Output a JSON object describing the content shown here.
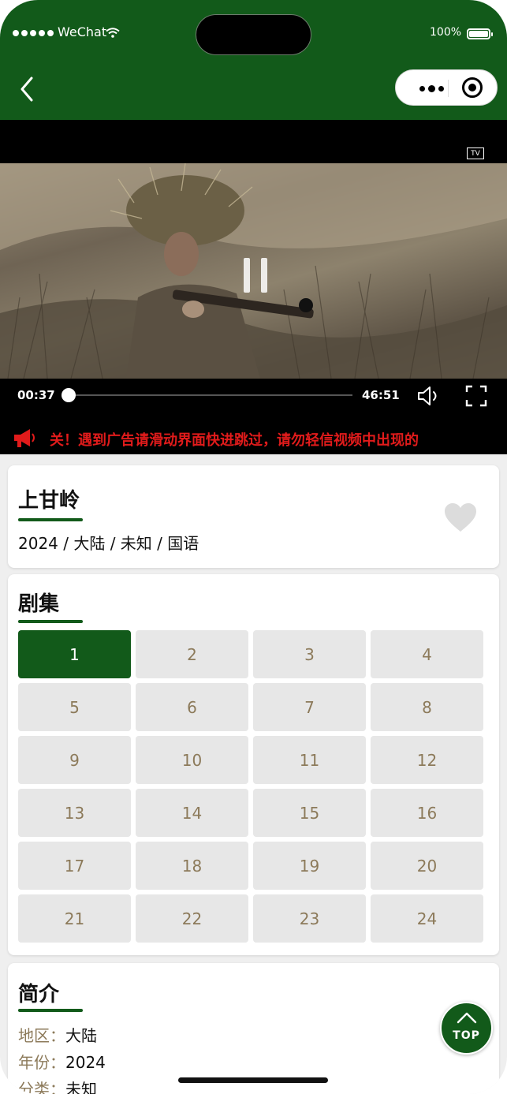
{
  "status_bar": {
    "carrier": "WeChat",
    "battery": "100%"
  },
  "video": {
    "badge": "TV",
    "current_time": "00:37",
    "total_time": "46:51",
    "progress": 0.013
  },
  "notice": {
    "text": "关！遇到广告请滑动界面快进跳过，请勿轻信视频中出现的"
  },
  "show": {
    "title": "上甘岭",
    "meta": "2024 / 大陆 / 未知 / 国语"
  },
  "episodes": {
    "title": "剧集",
    "active": "1",
    "items": [
      "1",
      "2",
      "3",
      "4",
      "5",
      "6",
      "7",
      "8",
      "9",
      "10",
      "11",
      "12",
      "13",
      "14",
      "15",
      "16",
      "17",
      "18",
      "19",
      "20",
      "21",
      "22",
      "23",
      "24"
    ]
  },
  "intro": {
    "title": "简介",
    "rows": [
      {
        "key": "地区：",
        "value": "大陆"
      },
      {
        "key": "年份：",
        "value": "2024"
      },
      {
        "key": "分类：",
        "value": "未知"
      }
    ]
  },
  "top_button": {
    "label": "TOP"
  },
  "colors": {
    "brand_green": "#125a1a",
    "notice_red": "#e11b1b",
    "episode_text": "#8c7a5a"
  }
}
